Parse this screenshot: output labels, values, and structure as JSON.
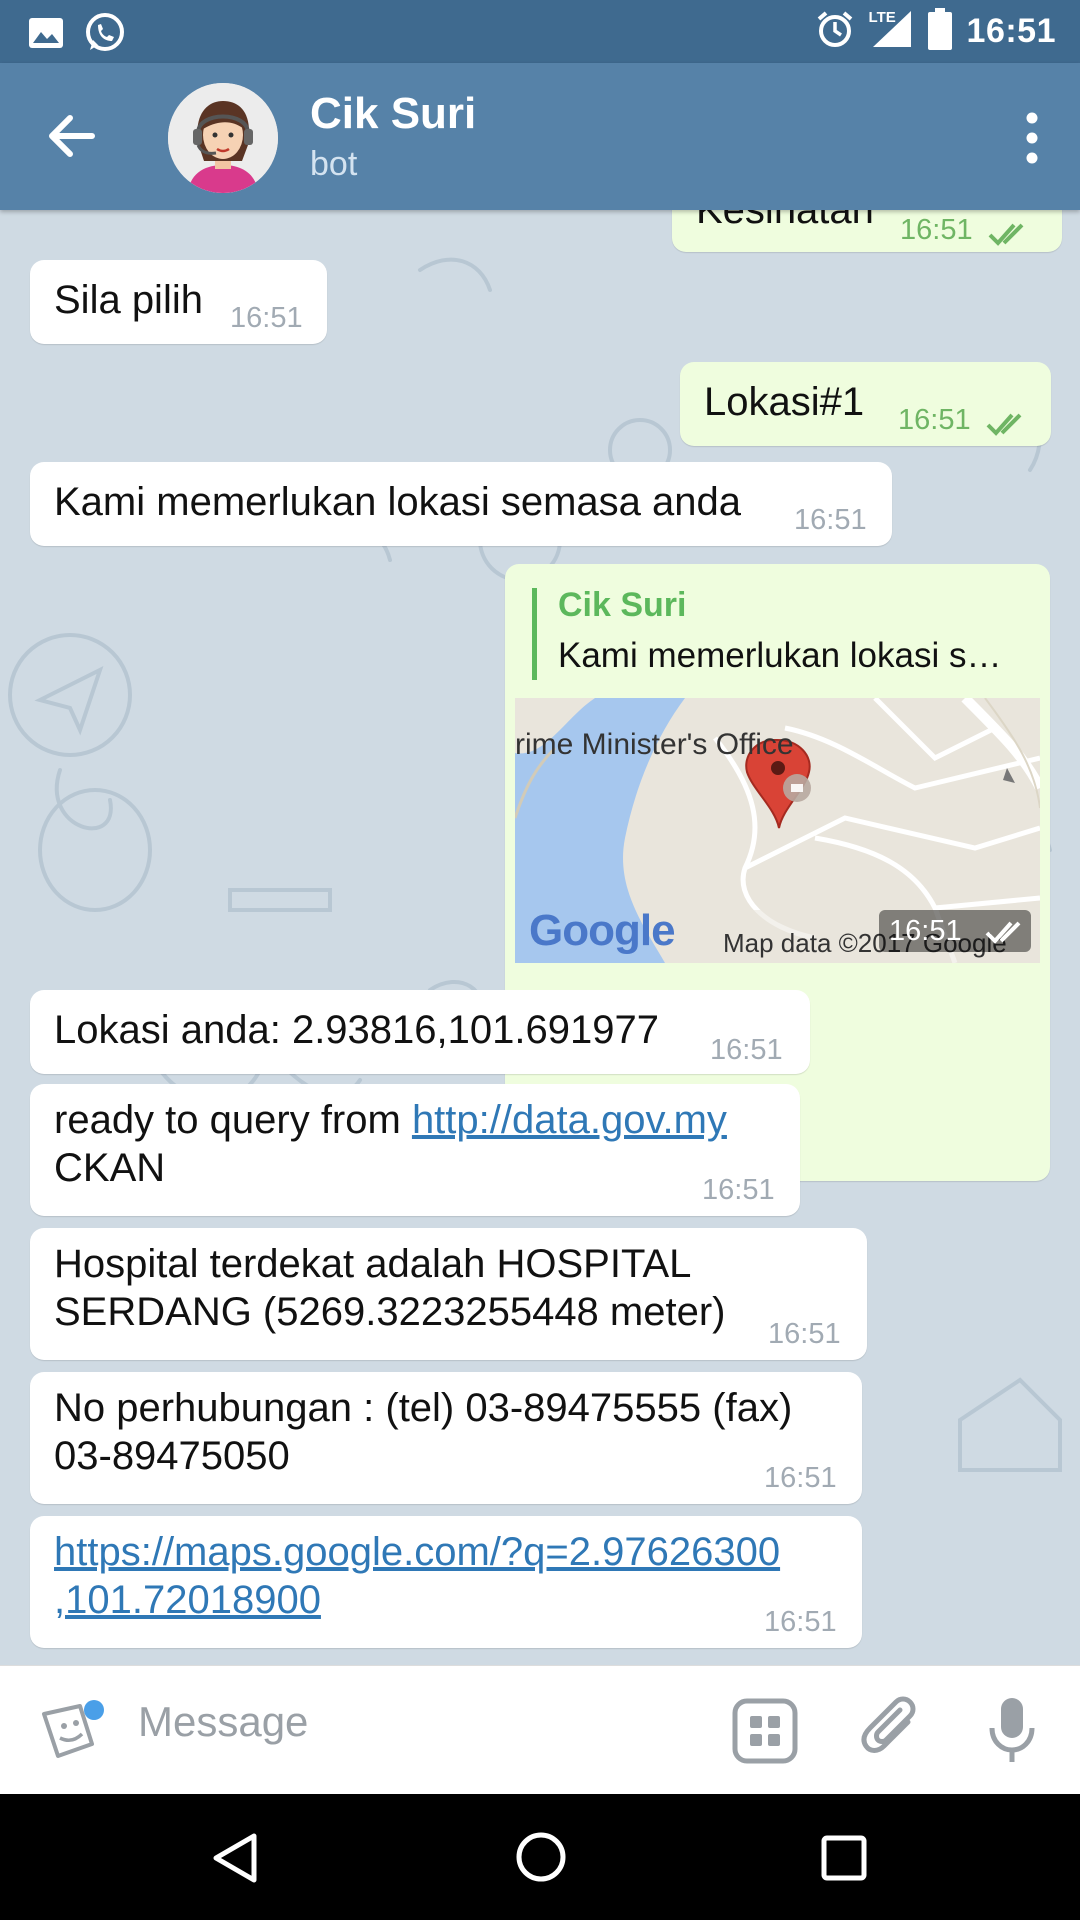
{
  "status_bar": {
    "time": "16:51",
    "network": "LTE",
    "icons": [
      "image-icon",
      "whatsapp-icon",
      "alarm-icon",
      "signal-icon",
      "battery-icon"
    ]
  },
  "header": {
    "title": "Cik Suri",
    "subtitle": "bot",
    "icons": [
      "back-arrow-icon",
      "bot-avatar",
      "more-vert-icon"
    ]
  },
  "messages": [
    {
      "dir": "out",
      "text": "Kesihatan",
      "time": "16:51"
    },
    {
      "dir": "in",
      "text": "Sila pilih",
      "time": "16:51"
    },
    {
      "dir": "out",
      "text": "Lokasi#1",
      "time": "16:51"
    },
    {
      "dir": "in",
      "text": "Kami memerlukan lokasi semasa anda",
      "time": "16:51"
    },
    {
      "dir": "out",
      "type": "location",
      "reply_name": "Cik Suri",
      "reply_text": "Kami memerlukan lokasi s…",
      "map_label": "rime Minister's Office",
      "map_logo": "Google",
      "map_credit": "Map data ©2017 Google",
      "time": "16:51"
    },
    {
      "dir": "in",
      "text": "Lokasi anda: 2.93816,101.691977",
      "time": "16:51"
    },
    {
      "dir": "in",
      "text_before": "ready to query from ",
      "link": "http://data.gov.my",
      "text_after": "CKAN",
      "time": "16:51"
    },
    {
      "dir": "in",
      "line1": "Hospital terdekat adalah HOSPITAL",
      "line2": "SERDANG (5269.3223255448 meter)",
      "time": "16:51"
    },
    {
      "dir": "in",
      "line1": "No perhubungan : (tel) 03-89475555 (fax)",
      "line2": "03-89475050",
      "time": "16:51"
    },
    {
      "dir": "in",
      "link_line1": "https://maps.google.com/?q=2.97626300",
      "link_line2": ",101.72018900",
      "time": "16:51"
    }
  ],
  "composer": {
    "placeholder": "Message",
    "icons": [
      "sticker-icon",
      "bot-keyboard-icon",
      "attach-icon",
      "mic-icon"
    ]
  },
  "nav": {
    "icons": [
      "nav-back-icon",
      "nav-home-icon",
      "nav-recents-icon"
    ]
  },
  "colors": {
    "header": "#5682a8",
    "status_bar": "#3f6a8f",
    "bubble_out": "#effdde",
    "bubble_in": "#ffffff",
    "time_out": "#6fb564",
    "link": "#2f78b6"
  }
}
